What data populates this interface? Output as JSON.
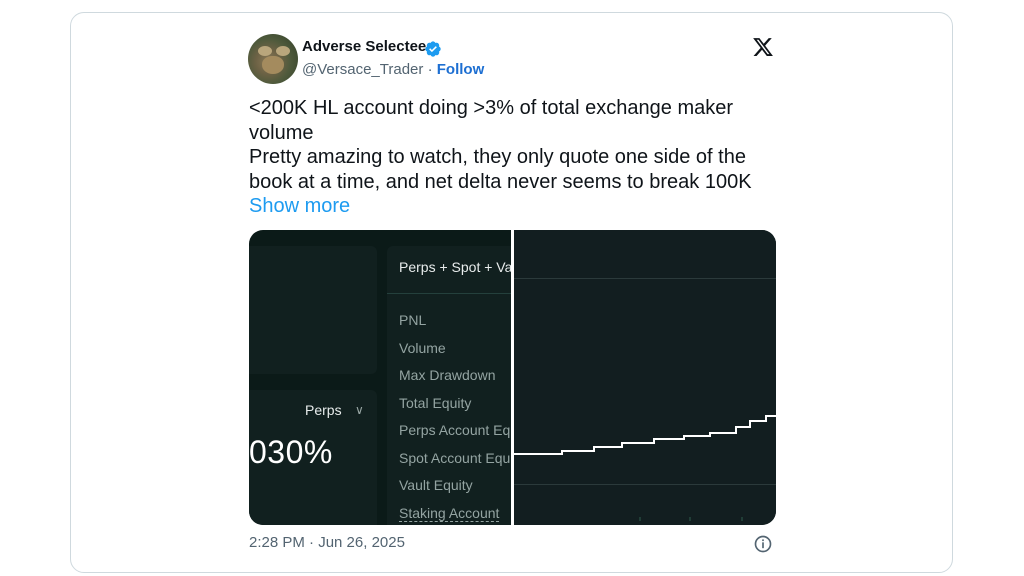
{
  "tweet": {
    "author": {
      "display_name": "Adverse Selectee",
      "handle": "@Versace_Trader",
      "separator": " · ",
      "follow_label": "Follow"
    },
    "text_lines": [
      "<200K HL account doing >3% of total exchange maker volume",
      "Pretty amazing to watch, they only quote one side of the book at a time, and net delta never seems to break 100K"
    ],
    "show_more_label": "Show more",
    "timestamp": "2:28 PM · Jun 26, 2025"
  },
  "media": {
    "left_panel": {
      "dropdown_label": "Perps",
      "value": "030%"
    },
    "stats_panel": {
      "header": "Perps + Spot + Va",
      "metrics": [
        "PNL",
        "Volume",
        "Max Drawdown",
        "Total Equity",
        "Perps Account Eq",
        "Spot Account Equ",
        "Vault Equity",
        "Staking Account"
      ]
    },
    "chart": {
      "type": "line",
      "line_color": "#ffffff",
      "background": "#121e20"
    }
  },
  "icons": {
    "verified": "verified-badge-icon",
    "platform": "x-logo-icon",
    "info": "info-icon"
  }
}
